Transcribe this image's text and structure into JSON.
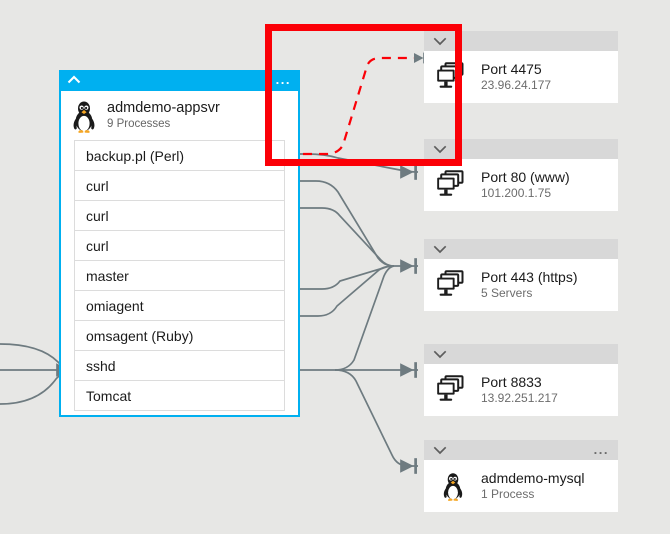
{
  "colors": {
    "canvas_background": "#e7e7e5",
    "machine_header": "#00b0f0",
    "resource_header": "#d8d8d8",
    "annotation_red": "#fb0007",
    "connector_gray": "#6e7b80",
    "card_white": "#ffffff"
  },
  "machine_card": {
    "collapse_icon": "chevron-up-icon",
    "menu_icon": "ellipsis-icon",
    "menu_label": "...",
    "os_icon": "linux-penguin-icon",
    "name": "admdemo-appsvr",
    "process_count": "9 Processes",
    "processes": [
      {
        "name": "backup.pl (Perl)"
      },
      {
        "name": "curl"
      },
      {
        "name": "curl"
      },
      {
        "name": "curl"
      },
      {
        "name": "master"
      },
      {
        "name": "omiagent"
      },
      {
        "name": "omsagent (Ruby)"
      },
      {
        "name": "sshd"
      },
      {
        "name": "Tomcat"
      }
    ]
  },
  "resources": [
    {
      "id": "port-4475",
      "expand_icon": "chevron-down-icon",
      "icon": "servers-stack-icon",
      "title": "Port 4475",
      "subtitle": "23.96.24.177",
      "has_menu": false,
      "menu_label": ""
    },
    {
      "id": "port-80",
      "expand_icon": "chevron-down-icon",
      "icon": "servers-stack-icon",
      "title": "Port 80 (www)",
      "subtitle": "101.200.1.75",
      "has_menu": false,
      "menu_label": ""
    },
    {
      "id": "port-443",
      "expand_icon": "chevron-down-icon",
      "icon": "servers-stack-icon",
      "title": "Port 443 (https)",
      "subtitle": "5 Servers",
      "has_menu": false,
      "menu_label": ""
    },
    {
      "id": "port-8833",
      "expand_icon": "chevron-down-icon",
      "icon": "servers-stack-icon",
      "title": "Port 8833",
      "subtitle": "13.92.251.217",
      "has_menu": false,
      "menu_label": ""
    },
    {
      "id": "admdemo-mysql",
      "expand_icon": "chevron-down-icon",
      "icon": "linux-penguin-icon",
      "title": "admdemo-mysql",
      "subtitle": "1 Process",
      "has_menu": true,
      "menu_label": "..."
    }
  ],
  "annotation": {
    "type": "highlight-rectangle",
    "color": "#fb0007",
    "highlighted_connection": "backup.pl (Perl) → Port 4475"
  }
}
